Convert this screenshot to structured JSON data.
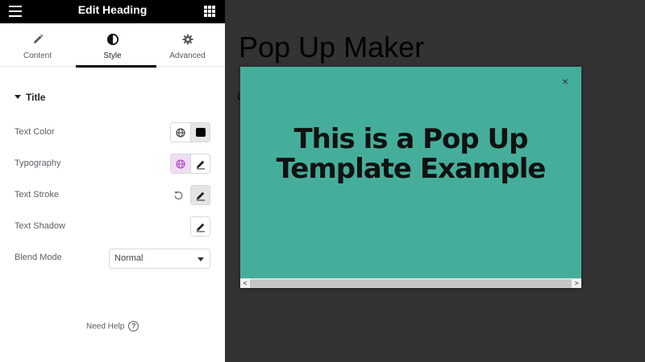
{
  "panel": {
    "header_title": "Edit Heading",
    "tabs": [
      {
        "label": "Content"
      },
      {
        "label": "Style"
      },
      {
        "label": "Advanced"
      }
    ],
    "section_title": "Title",
    "controls": {
      "text_color": "Text Color",
      "typography": "Typography",
      "text_stroke": "Text Stroke",
      "text_shadow": "Text Shadow",
      "blend_mode": "Blend Mode",
      "blend_mode_value": "Normal",
      "text_color_swatch": "#000000"
    },
    "help_label": "Need Help",
    "help_glyph": "?"
  },
  "preview": {
    "page_title": "Pop Up Maker",
    "page_text_fragment": "C",
    "popup": {
      "heading": "This is a Pop Up Template Example",
      "close_glyph": "×",
      "background": "#45ae9b"
    },
    "scrollbar": {
      "left_arrow": "<",
      "right_arrow": ">"
    }
  },
  "icons": [
    "menu-icon",
    "apps-grid-icon",
    "pencil-icon",
    "contrast-icon",
    "gear-icon",
    "globe-icon",
    "reset-icon",
    "help-icon",
    "close-icon"
  ]
}
